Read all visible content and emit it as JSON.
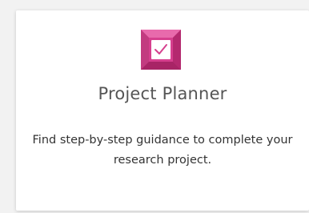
{
  "card": {
    "icon": "checkbox-icon",
    "accent_color": "#d63f8e",
    "title": "Project Planner",
    "description": "Find step-by-step guidance to complete your research project."
  }
}
